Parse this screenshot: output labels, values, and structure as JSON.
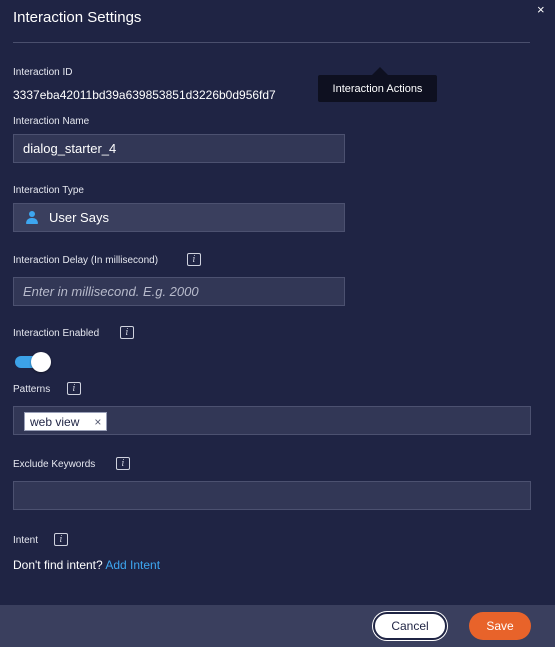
{
  "dialog": {
    "title": "Interaction Settings",
    "close_symbol": "×"
  },
  "tooltip": {
    "text": "Interaction Actions"
  },
  "interaction_id": {
    "label": "Interaction ID",
    "value": "3337eba42011bd39a639853851d3226b0d956fd7"
  },
  "interaction_name": {
    "label": "Interaction Name",
    "value": "dialog_starter_4"
  },
  "interaction_type": {
    "label": "Interaction Type",
    "value": "User Says",
    "icon": "user-icon",
    "icon_color": "#3da6f0"
  },
  "interaction_delay": {
    "label": "Interaction Delay (In millisecond)",
    "placeholder": "Enter in millisecond. E.g. 2000",
    "info": "i"
  },
  "interaction_enabled": {
    "label": "Interaction Enabled",
    "info": "i",
    "enabled": true,
    "toggle_color": "#3ca2e8"
  },
  "patterns": {
    "label": "Patterns",
    "info": "i",
    "chips": [
      {
        "text": "web view",
        "remove_symbol": "×"
      }
    ]
  },
  "exclude_keywords": {
    "label": "Exclude Keywords",
    "info": "i",
    "value": ""
  },
  "intent": {
    "label": "Intent",
    "info": "i",
    "prompt": "Don't find intent?",
    "link": "Add Intent",
    "link_color": "#3da6f0"
  },
  "footer": {
    "cancel_label": "Cancel",
    "save_label": "Save",
    "save_color": "#e8632a"
  }
}
